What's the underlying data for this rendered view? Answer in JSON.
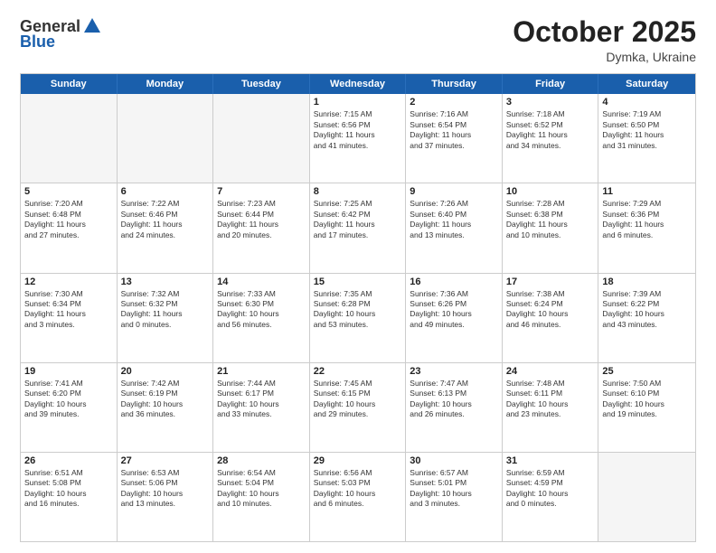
{
  "logo": {
    "general": "General",
    "blue": "Blue"
  },
  "title": "October 2025",
  "subtitle": "Dymka, Ukraine",
  "days": [
    "Sunday",
    "Monday",
    "Tuesday",
    "Wednesday",
    "Thursday",
    "Friday",
    "Saturday"
  ],
  "weeks": [
    [
      {
        "day": "",
        "info": "",
        "empty": true
      },
      {
        "day": "",
        "info": "",
        "empty": true
      },
      {
        "day": "",
        "info": "",
        "empty": true
      },
      {
        "day": "1",
        "info": "Sunrise: 7:15 AM\nSunset: 6:56 PM\nDaylight: 11 hours\nand 41 minutes."
      },
      {
        "day": "2",
        "info": "Sunrise: 7:16 AM\nSunset: 6:54 PM\nDaylight: 11 hours\nand 37 minutes."
      },
      {
        "day": "3",
        "info": "Sunrise: 7:18 AM\nSunset: 6:52 PM\nDaylight: 11 hours\nand 34 minutes."
      },
      {
        "day": "4",
        "info": "Sunrise: 7:19 AM\nSunset: 6:50 PM\nDaylight: 11 hours\nand 31 minutes."
      }
    ],
    [
      {
        "day": "5",
        "info": "Sunrise: 7:20 AM\nSunset: 6:48 PM\nDaylight: 11 hours\nand 27 minutes."
      },
      {
        "day": "6",
        "info": "Sunrise: 7:22 AM\nSunset: 6:46 PM\nDaylight: 11 hours\nand 24 minutes."
      },
      {
        "day": "7",
        "info": "Sunrise: 7:23 AM\nSunset: 6:44 PM\nDaylight: 11 hours\nand 20 minutes."
      },
      {
        "day": "8",
        "info": "Sunrise: 7:25 AM\nSunset: 6:42 PM\nDaylight: 11 hours\nand 17 minutes."
      },
      {
        "day": "9",
        "info": "Sunrise: 7:26 AM\nSunset: 6:40 PM\nDaylight: 11 hours\nand 13 minutes."
      },
      {
        "day": "10",
        "info": "Sunrise: 7:28 AM\nSunset: 6:38 PM\nDaylight: 11 hours\nand 10 minutes."
      },
      {
        "day": "11",
        "info": "Sunrise: 7:29 AM\nSunset: 6:36 PM\nDaylight: 11 hours\nand 6 minutes."
      }
    ],
    [
      {
        "day": "12",
        "info": "Sunrise: 7:30 AM\nSunset: 6:34 PM\nDaylight: 11 hours\nand 3 minutes."
      },
      {
        "day": "13",
        "info": "Sunrise: 7:32 AM\nSunset: 6:32 PM\nDaylight: 11 hours\nand 0 minutes."
      },
      {
        "day": "14",
        "info": "Sunrise: 7:33 AM\nSunset: 6:30 PM\nDaylight: 10 hours\nand 56 minutes."
      },
      {
        "day": "15",
        "info": "Sunrise: 7:35 AM\nSunset: 6:28 PM\nDaylight: 10 hours\nand 53 minutes."
      },
      {
        "day": "16",
        "info": "Sunrise: 7:36 AM\nSunset: 6:26 PM\nDaylight: 10 hours\nand 49 minutes."
      },
      {
        "day": "17",
        "info": "Sunrise: 7:38 AM\nSunset: 6:24 PM\nDaylight: 10 hours\nand 46 minutes."
      },
      {
        "day": "18",
        "info": "Sunrise: 7:39 AM\nSunset: 6:22 PM\nDaylight: 10 hours\nand 43 minutes."
      }
    ],
    [
      {
        "day": "19",
        "info": "Sunrise: 7:41 AM\nSunset: 6:20 PM\nDaylight: 10 hours\nand 39 minutes."
      },
      {
        "day": "20",
        "info": "Sunrise: 7:42 AM\nSunset: 6:19 PM\nDaylight: 10 hours\nand 36 minutes."
      },
      {
        "day": "21",
        "info": "Sunrise: 7:44 AM\nSunset: 6:17 PM\nDaylight: 10 hours\nand 33 minutes."
      },
      {
        "day": "22",
        "info": "Sunrise: 7:45 AM\nSunset: 6:15 PM\nDaylight: 10 hours\nand 29 minutes."
      },
      {
        "day": "23",
        "info": "Sunrise: 7:47 AM\nSunset: 6:13 PM\nDaylight: 10 hours\nand 26 minutes."
      },
      {
        "day": "24",
        "info": "Sunrise: 7:48 AM\nSunset: 6:11 PM\nDaylight: 10 hours\nand 23 minutes."
      },
      {
        "day": "25",
        "info": "Sunrise: 7:50 AM\nSunset: 6:10 PM\nDaylight: 10 hours\nand 19 minutes."
      }
    ],
    [
      {
        "day": "26",
        "info": "Sunrise: 6:51 AM\nSunset: 5:08 PM\nDaylight: 10 hours\nand 16 minutes."
      },
      {
        "day": "27",
        "info": "Sunrise: 6:53 AM\nSunset: 5:06 PM\nDaylight: 10 hours\nand 13 minutes."
      },
      {
        "day": "28",
        "info": "Sunrise: 6:54 AM\nSunset: 5:04 PM\nDaylight: 10 hours\nand 10 minutes."
      },
      {
        "day": "29",
        "info": "Sunrise: 6:56 AM\nSunset: 5:03 PM\nDaylight: 10 hours\nand 6 minutes."
      },
      {
        "day": "30",
        "info": "Sunrise: 6:57 AM\nSunset: 5:01 PM\nDaylight: 10 hours\nand 3 minutes."
      },
      {
        "day": "31",
        "info": "Sunrise: 6:59 AM\nSunset: 4:59 PM\nDaylight: 10 hours\nand 0 minutes."
      },
      {
        "day": "",
        "info": "",
        "empty": true
      }
    ]
  ]
}
